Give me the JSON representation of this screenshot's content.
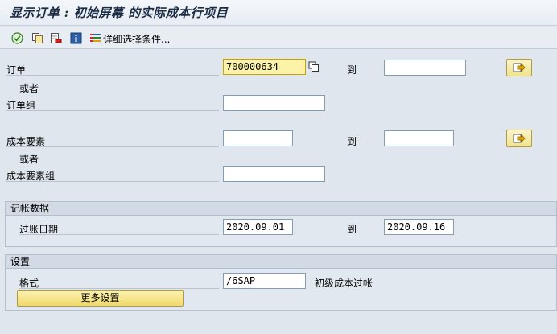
{
  "header": {
    "title": "显示订单 : 初始屏幕 的实际成本行项目"
  },
  "toolbar": {
    "icons": [
      "execute-icon",
      "copy-icon",
      "delete-icon",
      "info-icon",
      "selection-icon"
    ],
    "details_label": "详细选择条件..."
  },
  "order": {
    "label": "订单",
    "from_value": "700000634",
    "to_label": "到",
    "to_value": "",
    "or_label": "或者",
    "group_label": "订单组",
    "group_value": ""
  },
  "cost_element": {
    "label": "成本要素",
    "from_value": "",
    "to_label": "到",
    "to_value": "",
    "or_label": "或者",
    "group_label": "成本要素组",
    "group_value": ""
  },
  "posting": {
    "section_title": "记帐数据",
    "date_label": "过账日期",
    "date_from": "2020.09.01",
    "to_label": "到",
    "date_to": "2020.09.16"
  },
  "settings": {
    "section_title": "设置",
    "layout_label": "格式",
    "layout_value": "/6SAP",
    "layout_desc": "初级成本过帐",
    "more_button": "更多设置"
  },
  "colors": {
    "background": "#dfe6ee",
    "active_field": "#fdf3a8",
    "button": "#f0d96a"
  }
}
